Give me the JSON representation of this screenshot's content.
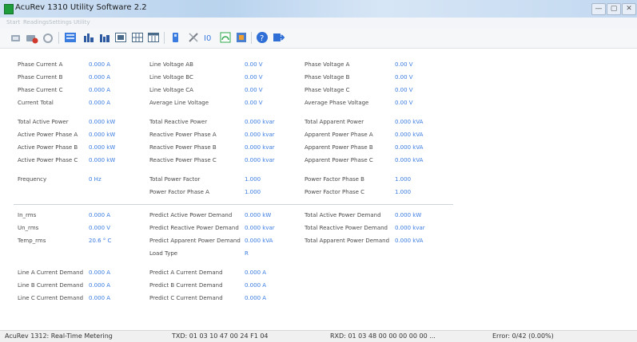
{
  "window": {
    "title": "AcuRev 1310 Utility Software 2.2",
    "minimize": "—",
    "maximize": "▢",
    "close": "✕"
  },
  "menu": [
    "Start",
    "Readings",
    "Settings",
    "Utility"
  ],
  "toolbar": [
    {
      "icon": "connect-icon",
      "color": "#7a8ea5"
    },
    {
      "icon": "disconnect-icon",
      "color": "#c0392b"
    },
    {
      "icon": "refresh-icon",
      "color": "#9aa5b2"
    },
    {
      "icon": "monitor-icon",
      "color": "#3a7be0"
    },
    {
      "icon": "bar-chart-icon",
      "color": "#2d5aa0"
    },
    {
      "icon": "bar-chart-alt-icon",
      "color": "#2d5aa0"
    },
    {
      "icon": "screen-icon",
      "color": "#4a6a8a"
    },
    {
      "icon": "grid-icon",
      "color": "#4a6a8a"
    },
    {
      "icon": "calendar-icon",
      "color": "#4a6a8a"
    },
    {
      "icon": "device-icon",
      "color": "#3a7be0"
    },
    {
      "icon": "tools-icon",
      "color": "#7a7f88"
    },
    {
      "icon": "io-icon",
      "color": "#3a7be0"
    },
    {
      "icon": "gauge-icon",
      "color": "#2fa84f"
    },
    {
      "icon": "report-icon",
      "color": "#e07b1a"
    },
    {
      "icon": "help-icon",
      "color": "#2f6fd6"
    },
    {
      "icon": "exit-icon",
      "color": "#2f6fd6"
    }
  ],
  "readings": {
    "phase_current_a": {
      "label": "Phase Current A",
      "value": "0.000 A"
    },
    "phase_current_b": {
      "label": "Phase Current B",
      "value": "0.000 A"
    },
    "phase_current_c": {
      "label": "Phase Current C",
      "value": "0.000 A"
    },
    "current_total": {
      "label": "Current Total",
      "value": "0.000 A"
    },
    "line_voltage_ab": {
      "label": "Line Voltage AB",
      "value": "0.00 V"
    },
    "line_voltage_bc": {
      "label": "Line Voltage BC",
      "value": "0.00 V"
    },
    "line_voltage_ca": {
      "label": "Line Voltage CA",
      "value": "0.00 V"
    },
    "average_line_voltage": {
      "label": "Average Line Voltage",
      "value": "0.00 V"
    },
    "phase_voltage_a": {
      "label": "Phase Voltage A",
      "value": "0.00 V"
    },
    "phase_voltage_b": {
      "label": "Phase Voltage B",
      "value": "0.00 V"
    },
    "phase_voltage_c": {
      "label": "Phase Voltage C",
      "value": "0.00 V"
    },
    "average_phase_voltage": {
      "label": "Average Phase Voltage",
      "value": "0.00 V"
    },
    "total_active_power": {
      "label": "Total Active Power",
      "value": "0.000 kW"
    },
    "active_power_a": {
      "label": "Active Power Phase A",
      "value": "0.000 kW"
    },
    "active_power_b": {
      "label": "Active Power Phase B",
      "value": "0.000 kW"
    },
    "active_power_c": {
      "label": "Active Power Phase C",
      "value": "0.000 kW"
    },
    "total_reactive_power": {
      "label": "Total Reactive Power",
      "value": "0.000 kvar"
    },
    "reactive_power_a": {
      "label": "Reactive Power Phase A",
      "value": "0.000 kvar"
    },
    "reactive_power_b": {
      "label": "Reactive Power Phase B",
      "value": "0.000 kvar"
    },
    "reactive_power_c": {
      "label": "Reactive Power Phase C",
      "value": "0.000 kvar"
    },
    "total_apparent_power": {
      "label": "Total Apparent Power",
      "value": "0.000 kVA"
    },
    "apparent_power_a": {
      "label": "Apparent Power Phase A",
      "value": "0.000 kVA"
    },
    "apparent_power_b": {
      "label": "Apparent Power Phase B",
      "value": "0.000 kVA"
    },
    "apparent_power_c": {
      "label": "Apparent Power Phase C",
      "value": "0.000 kVA"
    },
    "frequency": {
      "label": "Frequency",
      "value": "0 Hz"
    },
    "total_power_factor": {
      "label": "Total Power Factor",
      "value": "1.000"
    },
    "power_factor_a": {
      "label": "Power Factor Phase A",
      "value": "1.000"
    },
    "power_factor_b": {
      "label": "Power Factor Phase B",
      "value": "1.000"
    },
    "power_factor_c": {
      "label": "Power Factor Phase C",
      "value": "1.000"
    },
    "in_rms": {
      "label": "In_rms",
      "value": "0.000 A"
    },
    "un_rms": {
      "label": "Un_rms",
      "value": "0.000 V"
    },
    "temp_rms": {
      "label": "Temp_rms",
      "value": "20.6 ° C"
    },
    "predict_active_demand": {
      "label": "Predict Active Power Demand",
      "value": "0.000 kW"
    },
    "predict_reactive_demand": {
      "label": "Predict Reactive Power Demand",
      "value": "0.000 kvar"
    },
    "predict_apparent_demand": {
      "label": "Predict Apparent Power Demand",
      "value": "0.000 kVA"
    },
    "load_type": {
      "label": "Load Type",
      "value": "R"
    },
    "total_active_demand": {
      "label": "Total Active Power Demand",
      "value": "0.000 kW"
    },
    "total_reactive_demand": {
      "label": "Total Reactive Power Demand",
      "value": "0.000 kvar"
    },
    "total_apparent_demand": {
      "label": "Total Apparent Power Demand",
      "value": "0.000 kVA"
    },
    "line_a_current_demand": {
      "label": "Line A Current Demand",
      "value": "0.000 A"
    },
    "line_b_current_demand": {
      "label": "Line B Current Demand",
      "value": "0.000 A"
    },
    "line_c_current_demand": {
      "label": "Line C Current Demand",
      "value": "0.000 A"
    },
    "predict_a_current_demand": {
      "label": "Predict A Current Demand",
      "value": "0.000 A"
    },
    "predict_b_current_demand": {
      "label": "Predict B Current Demand",
      "value": "0.000 A"
    },
    "predict_c_current_demand": {
      "label": "Predict C Current Demand",
      "value": "0.000 A"
    }
  },
  "status": {
    "mode": "AcuRev 1312: Real-Time Metering",
    "txd": "TXD:  01 03 10 47 00 24 F1 04",
    "rxd": "RXD:  01 03 48 00 00 00 00 00 ...",
    "error": "Error:  0/42  (0.00%)"
  }
}
